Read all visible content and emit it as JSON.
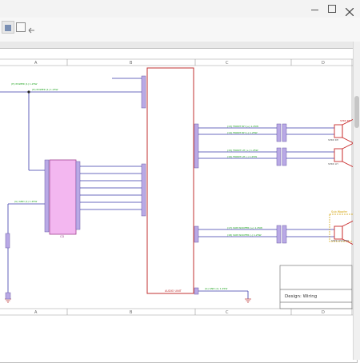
{
  "window": {
    "title": "",
    "buttons": [
      "minimize",
      "maximize",
      "close"
    ]
  },
  "toolbar": {
    "menu_icon": "app-menu-icon",
    "icons": [
      "save-icon",
      "undo-icon",
      "redo-icon",
      "print-icon"
    ]
  },
  "drawing": {
    "zones_top": [
      "A",
      "B",
      "C",
      "D"
    ],
    "zones_bottom": [
      "A",
      "B",
      "C",
      "D"
    ],
    "blocks": {
      "audio_unit": "AUDIO UNIT",
      "cd_changer": "CD",
      "speaker_rh": "SPKR RH",
      "speaker_lh": "SPKR LH",
      "subwoofer": "SPKR WOOFER",
      "subwoofer_note": "Sub Woofer",
      "speaker_rh_tag": "SPKR RH",
      "speaker_lh_tag": "SPKR LH"
    },
    "title_block": {
      "design_label": "Design: Wiring"
    },
    "wire_labels": {
      "power_top": "(H) POWER (1) 1.25W",
      "power_lower": "(H) POWER (1) 1.25W",
      "gnd_left": "(G) GND (1) 1.25W",
      "front_rh_plus": "(13) FRONT RH (+) 1.25W",
      "front_rh_minus": "(14) FRONT RH (-) 1.25W",
      "front_lh_plus": "(15) FRONT LH (+) 1.25W",
      "front_lh_minus": "(16) FRONT LH (-) 1.25W",
      "sub_plus": "(17) SUB WOOFER (+) 1.25W",
      "sub_minus": "(18) SUB WOOFER (-) 1.25W",
      "gnd_bottom": "(G) GND (1) 1.25W"
    },
    "accent": {
      "wire": "#3a3aaa",
      "connector": "#b9a9e6",
      "audio_border": "#c03030",
      "cd_fill": "#f3b7f0",
      "speaker": "#c82828",
      "sub_note": "#d2a000",
      "label_green": "#18a018"
    }
  }
}
